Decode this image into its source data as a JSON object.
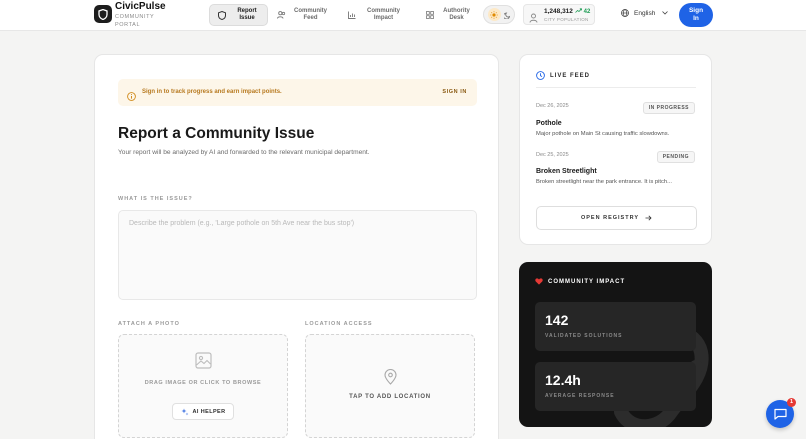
{
  "brand": {
    "name": "CivicPulse",
    "subtitle": "COMMUNITY PORTAL"
  },
  "nav": [
    {
      "label": "Report Issue",
      "icon": "shield-icon",
      "active": true
    },
    {
      "label": "Community Feed",
      "icon": "users-icon",
      "active": false
    },
    {
      "label": "Community Impact",
      "icon": "bar-chart-icon",
      "active": false
    },
    {
      "label": "Authority Desk",
      "icon": "grid-icon",
      "active": false
    }
  ],
  "population": {
    "value": "1,248,312",
    "delta": "42",
    "label": "CITY POPULATION"
  },
  "language": "English",
  "signin": "Sign In",
  "alert": {
    "text": "Sign in to track progress and earn impact points.",
    "action": "SIGN IN"
  },
  "report": {
    "title": "Report a Community Issue",
    "description": "Your report will be analyzed by AI and forwarded to the relevant municipal department.",
    "issue_label": "WHAT IS THE ISSUE?",
    "issue_placeholder": "Describe the problem (e.g., 'Large pothole on 5th Ave near the bus stop')",
    "photo_label": "ATTACH A PHOTO",
    "photo_drop": "DRAG IMAGE OR CLICK TO BROWSE",
    "ai_helper": "AI HELPER",
    "location_label": "LOCATION ACCESS",
    "location_action": "TAP TO ADD LOCATION"
  },
  "feed": {
    "title": "LIVE FEED",
    "items": [
      {
        "date": "Dec 26, 2025",
        "status": "IN PROGRESS",
        "title": "Pothole",
        "desc": "Major pothole on Main St causing traffic slowdowns."
      },
      {
        "date": "Dec 25, 2025",
        "status": "PENDING",
        "title": "Broken Streetlight",
        "desc": "Broken streetlight near the park entrance. It is pitch..."
      }
    ],
    "registry": "OPEN REGISTRY"
  },
  "impact": {
    "title": "COMMUNITY IMPACT",
    "stats": [
      {
        "value": "142",
        "label": "VALIDATED SOLUTIONS"
      },
      {
        "value": "12.4h",
        "label": "AVERAGE RESPONSE"
      }
    ]
  },
  "chat": {
    "badge": "1"
  },
  "colors": {
    "accent": "#1f63e6",
    "warning": "#b7791f",
    "positive": "#1f9d55",
    "heart": "#e53935"
  }
}
